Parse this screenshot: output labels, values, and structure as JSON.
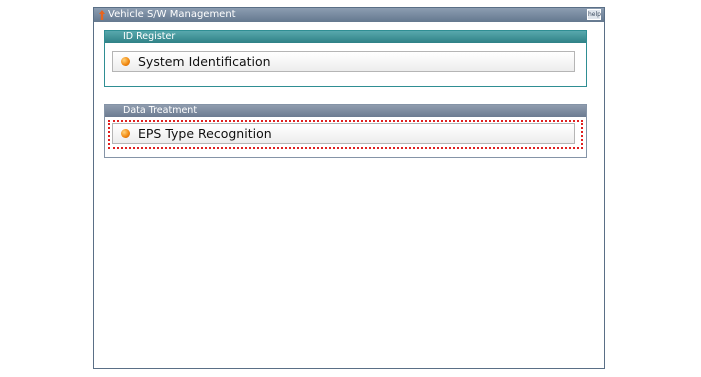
{
  "window": {
    "title": "Vehicle S/W Management",
    "help_label": "help"
  },
  "groups": [
    {
      "header": "ID Register",
      "items": [
        {
          "label": "System Identification"
        }
      ]
    },
    {
      "header": "Data Treatment",
      "items": [
        {
          "label": "EPS Type Recognition",
          "highlighted": true
        }
      ]
    }
  ],
  "colors": {
    "titlebar": "#6f8299",
    "id_register_header": "#3f9499",
    "data_treatment_header": "#7b8aa0",
    "bullet": "#f28a12",
    "highlight": "#e02020"
  },
  "icons": {
    "title": "vehicle-icon",
    "help": "help-icon",
    "bullet": "orange-bullet-icon"
  }
}
